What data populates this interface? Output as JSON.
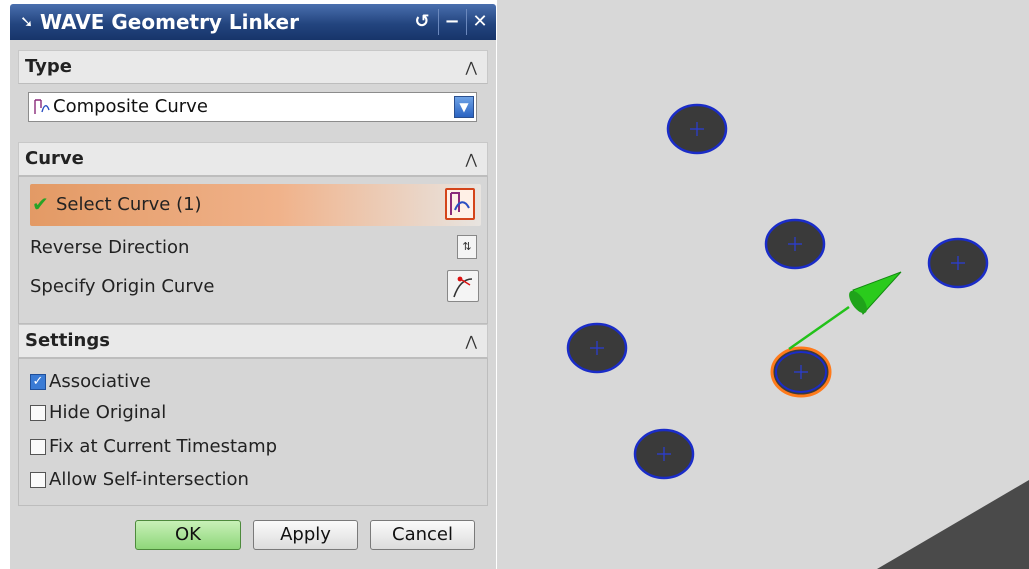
{
  "dialog": {
    "title": "WAVE Geometry Linker",
    "title_icon": "arrow-cursor-icon",
    "buttons": {
      "reset_icon": "reset-icon",
      "minimize_icon": "minimize-icon",
      "close_icon": "close-icon"
    }
  },
  "type_group": {
    "label": "Type",
    "collapse_icon": "chevron-up-icon",
    "selected": "Composite Curve",
    "selected_icon": "composite-curve-icon"
  },
  "curve_group": {
    "label": "Curve",
    "collapse_icon": "chevron-up-icon",
    "select_curve": "Select Curve (1)",
    "select_status_icon": "checkmark-icon",
    "select_icon": "curve-select-icon",
    "reverse_direction": "Reverse Direction",
    "reverse_icon": "reverse-direction-icon",
    "specify_origin": "Specify Origin Curve",
    "origin_icon": "origin-curve-icon"
  },
  "settings_group": {
    "label": "Settings",
    "collapse_icon": "chevron-up-icon",
    "options": [
      {
        "label": "Associative",
        "checked": true
      },
      {
        "label": "Hide Original",
        "checked": false
      },
      {
        "label": "Fix at Current Timestamp",
        "checked": false
      },
      {
        "label": "Allow Self-intersection",
        "checked": false
      }
    ]
  },
  "footer": {
    "ok": "OK",
    "apply": "Apply",
    "cancel": "Cancel"
  },
  "viewport": {
    "background_color": "#d8d8d8",
    "hole_fill_color": "#3a3a3a",
    "hole_outline_color": "#1a2cc8",
    "selected_outline_color": "#ff7a1a",
    "vector_color": "#22c21a",
    "hole_count": 6,
    "selected_hole_count": 1
  },
  "colors": {
    "titlebar": "#23457f",
    "select_highlight": "#e39a65",
    "ok_button": "#8fd77a"
  }
}
